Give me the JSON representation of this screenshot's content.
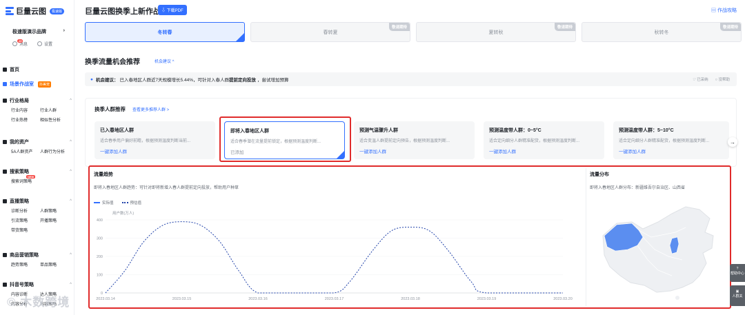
{
  "sidebar": {
    "logo": "巨量云图",
    "logo_badge": "极速版",
    "brand": "极速版演示品牌",
    "messages": "消息",
    "messages_count": "25",
    "settings": "设置",
    "nav": [
      {
        "label": "首页"
      },
      {
        "label": "场景作战室",
        "tag": "抖美宠"
      },
      {
        "label": "行业格局",
        "subs": [
          "行业内容",
          "行业人群",
          "行业热榜",
          "相似性分析"
        ]
      },
      {
        "label": "我的资产",
        "subs": [
          "5A人群资产",
          "人群行为分析"
        ]
      },
      {
        "label": "搜索策略",
        "subs": [
          "搜索词策略"
        ],
        "sub_tag": "NEW"
      },
      {
        "label": "直播策略",
        "subs": [
          "诊断分析",
          "人群策略",
          "引流策略",
          "开播策略",
          "带货策略"
        ]
      },
      {
        "label": "商品营销策略",
        "subs": [
          "趋势策略",
          "单品策略"
        ]
      },
      {
        "label": "抖音号策略",
        "subs": [
          "内容诊断",
          "达人策略",
          "内容分析",
          "内容策略"
        ]
      }
    ]
  },
  "header": {
    "title": "巨量云图换季上新作战",
    "pdf_button": "下载PDF",
    "guide": "作战攻略"
  },
  "seasons": [
    {
      "label": "冬转春",
      "active": true
    },
    {
      "label": "春转夏",
      "badge": "敬请期待"
    },
    {
      "label": "夏转秋",
      "badge": "敬请期待"
    },
    {
      "label": "秋转冬",
      "badge": "敬请期待"
    }
  ],
  "opportunity": {
    "title": "换季流量机会推荐",
    "link": "机会建议 ^",
    "advice_label": "机会建议：",
    "advice_text": "已入春地区人群近7天规模增长5.44%，可针对入春人群",
    "advice_bold": "提前定向投放",
    "advice_tail": "，尝试增加预算",
    "adopted": "已采纳",
    "useless": "没帮助"
  },
  "recommend": {
    "title": "换季人群推荐",
    "more": "查看更多推荐人群 >",
    "cards": [
      {
        "title": "已入春地区人群",
        "desc": "适合春季用户偏好前瞻，根据预测温度判断当前...",
        "action": "一键添加人群"
      },
      {
        "title": "即将入春地区人群",
        "desc": "适合春季潜在流量提前锁定，根据预测温度判断...",
        "action": "已添加",
        "selected": true
      },
      {
        "title": "预测气温骤升人群",
        "desc": "适合变温人群提前定向预告，根据预测温度判断...",
        "action": "一键添加人群"
      },
      {
        "title": "预测温度带人群：0~5°C",
        "desc": "适合定向细分人群精准配货，根据预测温度判断...",
        "action": "一键添加人群"
      },
      {
        "title": "预测温度带人群：5~10°C",
        "desc": "适合定向细分人群精准配货，根据预测温度判断...",
        "action": "一键添加人群"
      }
    ]
  },
  "trend": {
    "title": "流量趋势",
    "desc": "即将入春地区人群趋势：可针对即将新增入春人群提前定向投放，帮助用户种草",
    "legend_actual": "实际值",
    "legend_forecast": "预估值"
  },
  "distribution": {
    "title": "流量分布",
    "desc": "即将入春地区人群分布：新疆维吾尔自治区、山西省"
  },
  "float": {
    "help": "帮助中心",
    "entry": "人群关"
  },
  "watermark": "© 木数跨境",
  "colors": {
    "accent": "#3370ff",
    "highlight": "#e02b2b",
    "map_base": "#eef0f3",
    "map_highlight": "#5b8ef0"
  },
  "chart_data": {
    "type": "line",
    "ylabel": "用户数(万人)",
    "ylim": [
      0,
      400
    ],
    "yticks": [
      0,
      100,
      200,
      300,
      400
    ],
    "x": [
      "2023.03.14",
      "2023.03.15",
      "2023.03.16",
      "2023.03.17",
      "2023.03.18",
      "2023.03.19",
      "2023.03.20"
    ],
    "series": [
      {
        "name": "预估值",
        "style": "dotted",
        "color": "#1d3fa8",
        "points": [
          [
            0,
            0
          ],
          [
            0.25,
            120
          ],
          [
            0.5,
            280
          ],
          [
            0.75,
            370
          ],
          [
            1,
            390
          ],
          [
            1.25,
            370
          ],
          [
            1.5,
            280
          ],
          [
            1.75,
            120
          ],
          [
            2,
            0
          ],
          [
            2.5,
            0
          ],
          [
            3,
            0
          ],
          [
            3.2,
            60
          ],
          [
            3.5,
            230
          ],
          [
            3.75,
            340
          ],
          [
            4,
            360
          ],
          [
            4.25,
            340
          ],
          [
            4.5,
            230
          ],
          [
            4.8,
            60
          ],
          [
            5,
            0
          ],
          [
            6,
            0
          ]
        ]
      }
    ]
  }
}
